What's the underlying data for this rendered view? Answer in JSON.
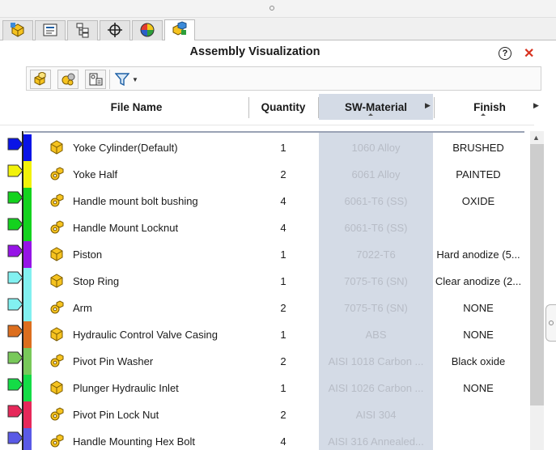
{
  "panel": {
    "title": "Assembly Visualization",
    "help_glyph": "?",
    "close_glyph": "✕"
  },
  "tabs": [
    {
      "icon": "feature-manager-icon",
      "active": false
    },
    {
      "icon": "property-manager-icon",
      "active": false
    },
    {
      "icon": "configuration-manager-icon",
      "active": false
    },
    {
      "icon": "dimxpert-manager-icon",
      "active": false
    },
    {
      "icon": "display-manager-icon",
      "active": false
    },
    {
      "icon": "assembly-visualization-icon",
      "active": true
    }
  ],
  "toolbar": {
    "buttons": [
      "assembly-parts-icon",
      "grouped-parts-icon",
      "properties-icon"
    ],
    "filter_icon": "filter-icon"
  },
  "columns": {
    "file_name": "File Name",
    "quantity": "Quantity",
    "material": "SW-Material",
    "finish": "Finish"
  },
  "rows": [
    {
      "name": "Yoke Cylinder(Default)",
      "quantity": "1",
      "material": "1060 Alloy",
      "finish": "BRUSHED",
      "color": "#0a14e6",
      "part_type": "part"
    },
    {
      "name": "Yoke Half",
      "quantity": "2",
      "material": "6061 Alloy",
      "finish": "PAINTED",
      "color": "#f2f20a",
      "part_type": "assembly"
    },
    {
      "name": "Handle mount bolt bushing",
      "quantity": "4",
      "material": "6061-T6 (SS)",
      "finish": "OXIDE",
      "color": "#14d21e",
      "part_type": "assembly"
    },
    {
      "name": "Handle Mount Locknut",
      "quantity": "4",
      "material": "6061-T6 (SS)",
      "finish": "",
      "color": "#14d21e",
      "part_type": "assembly"
    },
    {
      "name": "Piston",
      "quantity": "1",
      "material": "7022-T6",
      "finish": "Hard anodize (5...",
      "color": "#9614e6",
      "part_type": "part"
    },
    {
      "name": "Stop Ring",
      "quantity": "1",
      "material": "7075-T6 (SN)",
      "finish": "Clear anodize (2...",
      "color": "#82f0f0",
      "part_type": "part"
    },
    {
      "name": "Arm",
      "quantity": "2",
      "material": "7075-T6 (SN)",
      "finish": "NONE",
      "color": "#82f0f0",
      "part_type": "assembly"
    },
    {
      "name": "Hydraulic Control Valve Casing",
      "quantity": "1",
      "material": "ABS",
      "finish": "NONE",
      "color": "#dc6e1e",
      "part_type": "part"
    },
    {
      "name": "Pivot Pin Washer",
      "quantity": "2",
      "material": "AISI 1018 Carbon ...",
      "finish": "Black oxide",
      "color": "#78c85a",
      "part_type": "assembly"
    },
    {
      "name": "Plunger Hydraulic Inlet",
      "quantity": "1",
      "material": "AISI 1026 Carbon ...",
      "finish": "NONE",
      "color": "#14dc46",
      "part_type": "part"
    },
    {
      "name": "Pivot Pin Lock Nut",
      "quantity": "2",
      "material": "AISI 304",
      "finish": "",
      "color": "#e6285a",
      "part_type": "assembly"
    },
    {
      "name": "Handle Mounting Hex Bolt",
      "quantity": "4",
      "material": "AISI 316 Annealed...",
      "finish": "",
      "color": "#5a5ae6",
      "part_type": "assembly"
    }
  ]
}
